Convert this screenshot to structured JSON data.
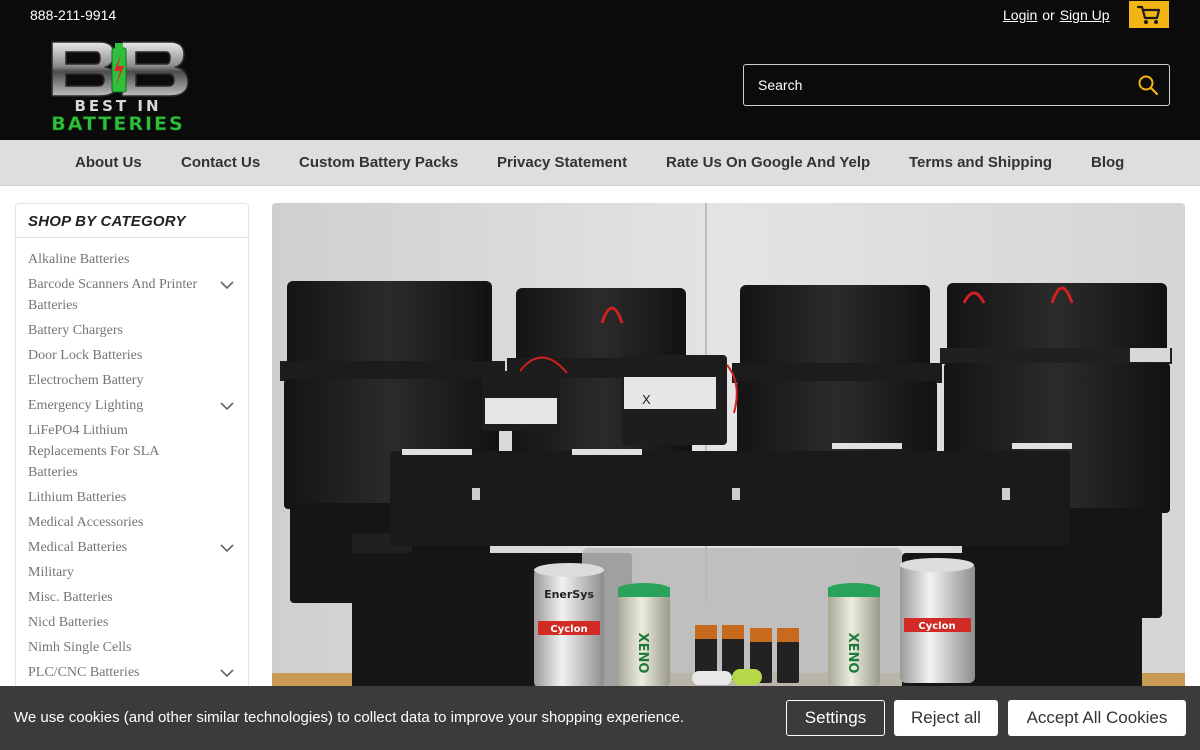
{
  "header": {
    "phone": "888-211-9914",
    "login": "Login",
    "or": "or",
    "signup": "Sign Up",
    "logo_line1": "BEST IN",
    "logo_line2": "BATTERIES"
  },
  "search": {
    "placeholder": "Search"
  },
  "nav": {
    "items": [
      "About Us",
      "Contact Us",
      "Custom Battery Packs",
      "Privacy Statement",
      "Rate Us On Google And Yelp",
      "Terms and Shipping",
      "Blog"
    ]
  },
  "sidebar": {
    "title": "SHOP BY CATEGORY",
    "items": [
      "Alkaline Batteries",
      "Barcode Scanners And Printer Batteries",
      "Battery Chargers",
      "Door Lock Batteries",
      "Electrochem Battery",
      "Emergency Lighting",
      "LiFePO4 Lithium Replacements For SLA Batteries",
      "Lithium Batteries",
      "Medical Accessories",
      "Medical Batteries",
      "Military",
      "Misc. Batteries",
      "Nicd Batteries",
      "Nimh Single Cells",
      "PLC/CNC Batteries"
    ]
  },
  "hero": {
    "cell_brand_1": "EnerSys",
    "cell_brand_2": "Cyclon",
    "cell_brand_3": "XENO",
    "pack_label": "X"
  },
  "cookie": {
    "message": "We use cookies (and other similar technologies) to collect data to improve your shopping experience.",
    "settings": "Settings",
    "reject": "Reject all",
    "accept": "Accept All Cookies"
  },
  "colors": {
    "header_bg": "#0b0b0b",
    "cart_accent": "#f3b515",
    "nav_bg": "#dedede",
    "cookie_bg": "#3b3b3b",
    "logo_green": "#2fbf3a"
  }
}
